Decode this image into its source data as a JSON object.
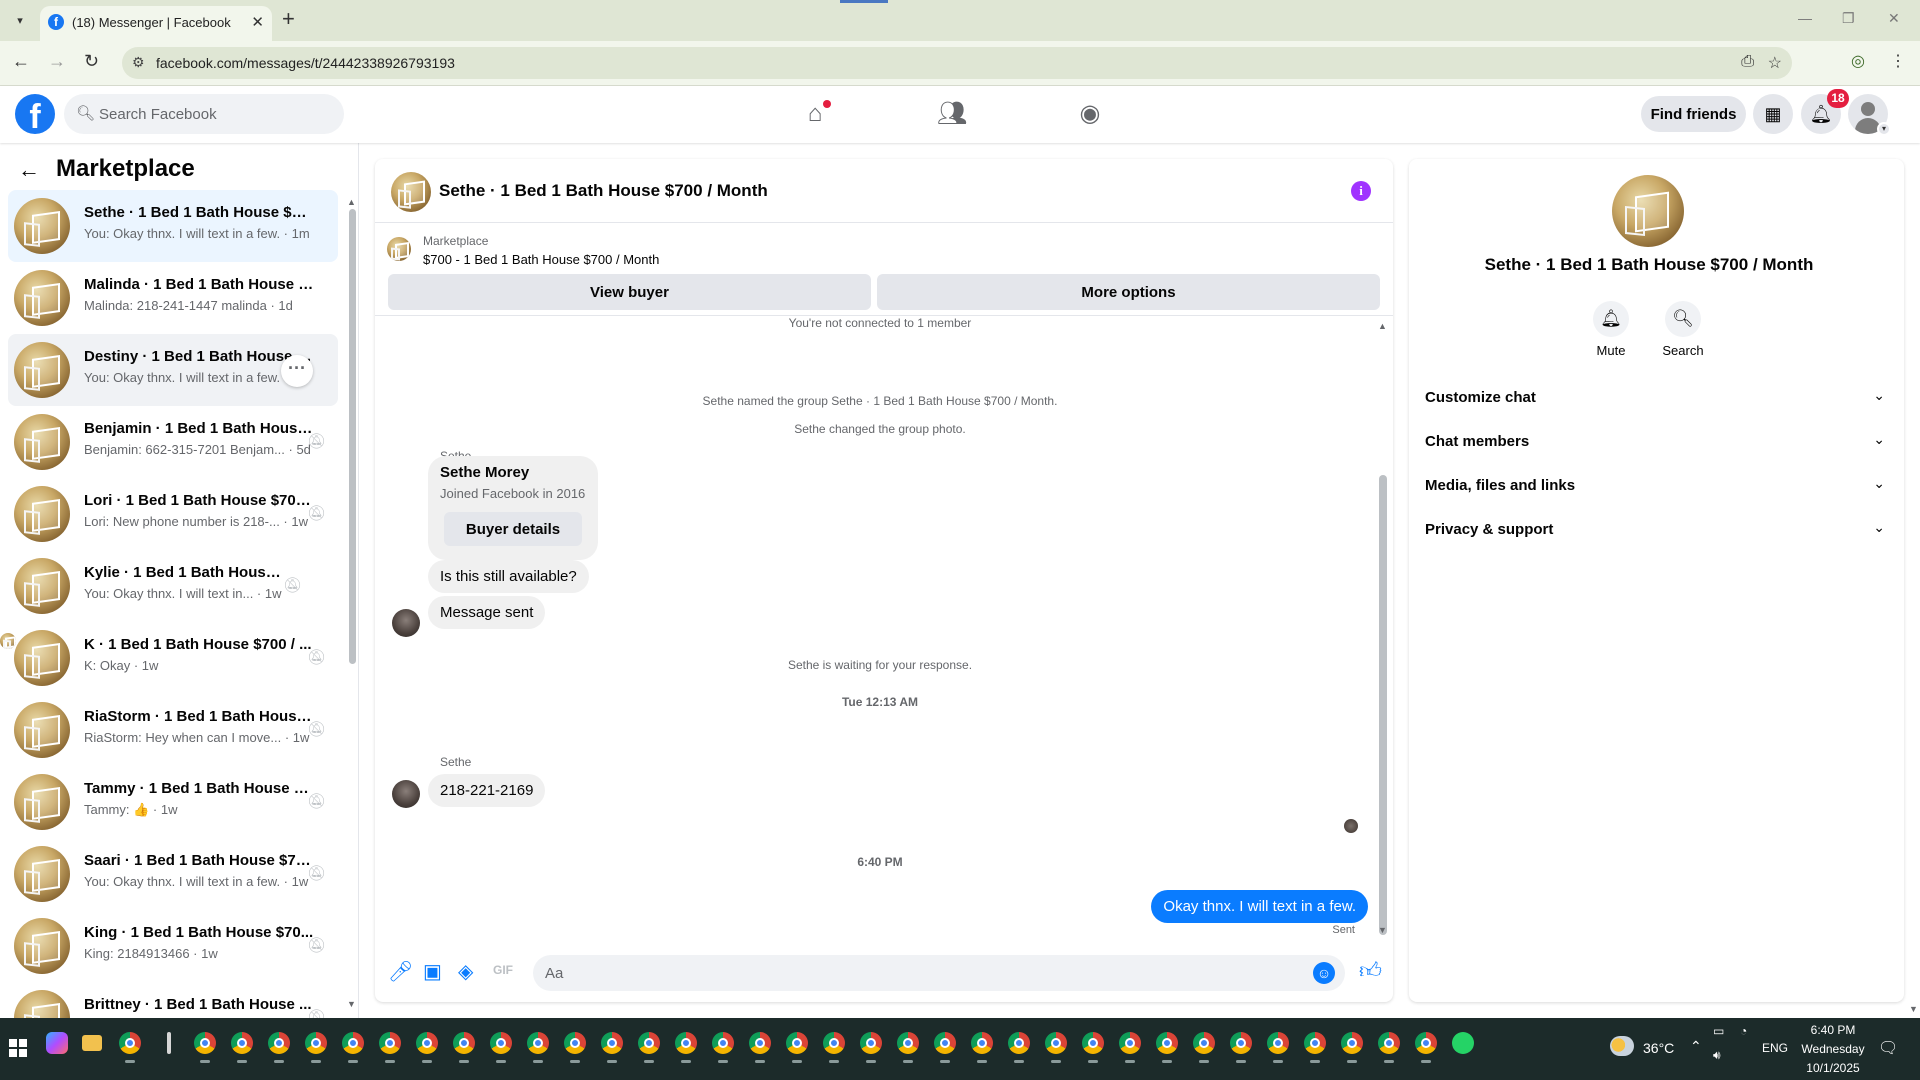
{
  "browser": {
    "tab_title": "(18) Messenger | Facebook",
    "favicon_letter": "f",
    "url": "facebook.com/messages/t/24442338926793193"
  },
  "fb_nav": {
    "logo_letter": "f",
    "search_placeholder": "Search Facebook",
    "find_friends_label": "Find friends",
    "notification_count": "18"
  },
  "sidebar": {
    "title": "Marketplace",
    "conversations": [
      {
        "name": "Sethe · 1 Bed 1 Bath House $700 ...",
        "preview": "You: Okay thnx. I will text in a few. · 1m"
      },
      {
        "name": "Malinda · 1 Bed 1 Bath House $7...",
        "preview": "Malinda: 218-241-1447 malinda · 1d"
      },
      {
        "name": "Destiny · 1 Bed 1 Bath House $7...",
        "preview": "You: Okay thnx. I will text in a few. · 1d"
      },
      {
        "name": "Benjamin · 1 Bed 1 Bath House...",
        "preview": "Benjamin: 662-315-7201 Benjam... · 5d"
      },
      {
        "name": "Lori · 1 Bed 1 Bath House $700...",
        "preview": "Lori: New phone number is 218-... · 1w"
      },
      {
        "name": "Kylie · 1 Bed 1 Bath House ...",
        "preview": "You: Okay thnx. I will text in... · 1w"
      },
      {
        "name": "K · 1 Bed 1 Bath House $700 / ...",
        "preview": "K: Okay · 1w"
      },
      {
        "name": "RiaStorm · 1 Bed 1 Bath House...",
        "preview": "RiaStorm: Hey when can I move... · 1w"
      },
      {
        "name": "Tammy · 1 Bed 1 Bath House $...",
        "preview": "Tammy: 👍 · 1w"
      },
      {
        "name": "Saari · 1 Bed 1 Bath House $70...",
        "preview": "You: Okay thnx. I will text in a few. · 1w"
      },
      {
        "name": "King · 1 Bed 1 Bath House $70...",
        "preview": "King: 2184913466 · 1w"
      },
      {
        "name": "Brittney · 1 Bed 1 Bath House ...",
        "preview": ""
      }
    ]
  },
  "chat": {
    "title": "Sethe · 1 Bed 1 Bath House $700 / Month",
    "marketplace_label": "Marketplace",
    "listing": "$700 - 1 Bed 1 Bath House $700 / Month",
    "view_buyer_label": "View buyer",
    "more_options_label": "More options",
    "messages": {
      "not_connected": "You're not connected to 1 member",
      "named_group": "Sethe named the group Sethe · 1 Bed 1 Bath House $700 / Month.",
      "changed_photo": "Sethe changed the group photo.",
      "sender_1": "Sethe",
      "card_name": "Sethe Morey",
      "card_sub": "Joined Facebook in 2016",
      "buyer_details_label": "Buyer details",
      "msg_available": "Is this still available?",
      "msg_sent_notice": "Message sent",
      "waiting": "Sethe is waiting for your response.",
      "time_1": "Tue 12:13 AM",
      "sender_2": "Sethe",
      "msg_phone": "218-221-2169",
      "time_2": "6:40 PM",
      "msg_out": "Okay thnx. I will text in a few.",
      "sent_label": "Sent"
    },
    "composer_placeholder": "Aa"
  },
  "info_panel": {
    "name": "Sethe · 1 Bed 1 Bath House $700 / Month",
    "mute_label": "Mute",
    "search_label": "Search",
    "rows": [
      "Customize chat",
      "Chat members",
      "Media, files and links",
      "Privacy & support"
    ]
  },
  "taskbar": {
    "temperature": "36°C",
    "language": "ENG",
    "time": "6:40 PM",
    "day": "Wednesday",
    "date": "10/1/2025"
  }
}
